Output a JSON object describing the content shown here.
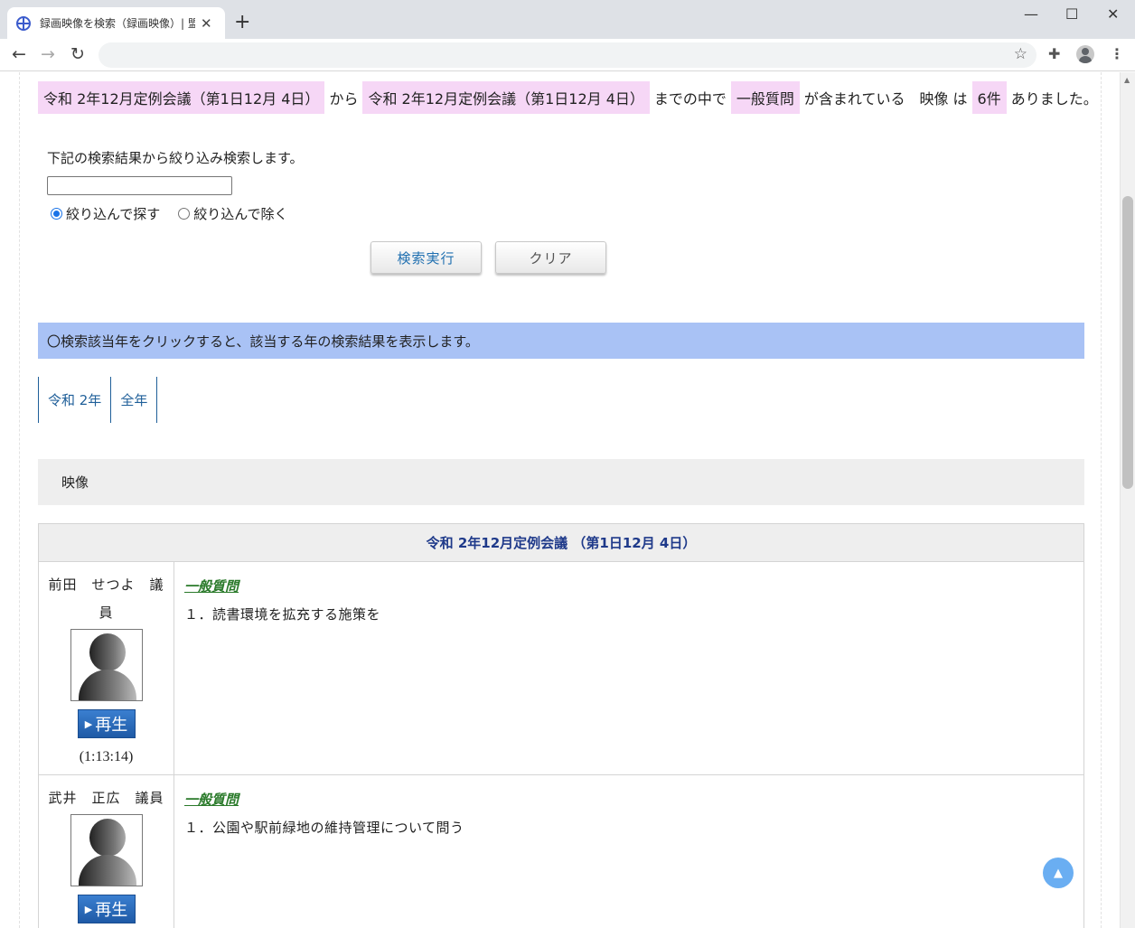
{
  "browser": {
    "tab_title": "録画映像を検索（録画映像）| 盟",
    "tab_close": "✕",
    "new_tab": "+",
    "win_minimize": "—",
    "win_maximize": "☐",
    "win_close": "✕"
  },
  "summary": {
    "from_session": "令和 2年12月定例会議（第1日12月 4日）",
    "from_word": "から",
    "to_session": "令和 2年12月定例会議（第1日12月 4日）",
    "until_word": "までの中で",
    "keyword": "一般質問",
    "contains_word": "が含まれている　映像 は",
    "count": "6件",
    "tail": "ありました。"
  },
  "refine": {
    "label": "下記の検索結果から絞り込み検索します。",
    "input_value": "",
    "radio_include": "絞り込んで探す",
    "radio_exclude": "絞り込んで除く",
    "selected": "include",
    "search_button": "検索実行",
    "clear_button": "クリア"
  },
  "info_bar": "〇検索該当年をクリックすると、該当する年の検索結果を表示します。",
  "year_tabs": [
    "令和 2年",
    "全年"
  ],
  "section_title": "映像",
  "results": {
    "session_header": "令和 2年12月定例会議 （第1日12月 4日）",
    "rows": [
      {
        "speaker": "前田　せつよ　議員",
        "play_label": "再生",
        "duration": "(1:13:14)",
        "topic": "一般質問",
        "item": "１．読書環境を拡充する施策を"
      },
      {
        "speaker": "武井　正広　議員",
        "play_label": "再生",
        "duration": "",
        "topic": "一般質問",
        "item": "１．公園や駅前緑地の維持管理について問う"
      }
    ]
  },
  "colors": {
    "highlight": "#f6d7f6",
    "info_bar": "#a9c2f5",
    "link_blue": "#1f5f99",
    "topic_green": "#2a7a2a",
    "play_button": "#1f5aa6"
  }
}
